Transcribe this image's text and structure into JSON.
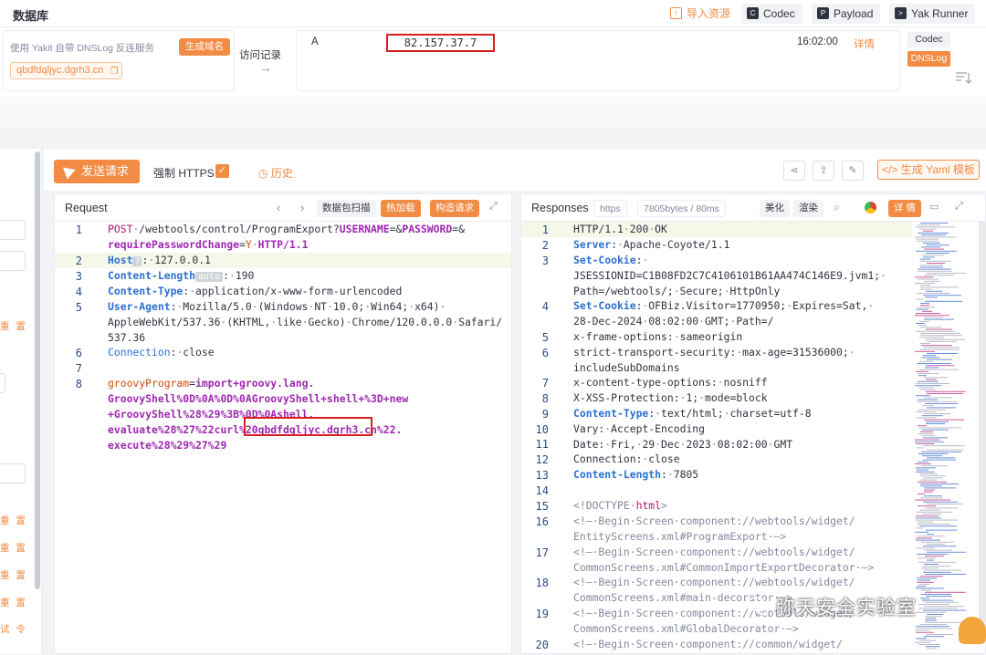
{
  "topbar": {
    "title": "数据库",
    "buttons": [
      {
        "label": "导入资源",
        "icon": "import-icon"
      },
      {
        "label": "Codec",
        "icon": "codec-icon"
      },
      {
        "label": "Payload",
        "icon": "payload-icon"
      },
      {
        "label": "Yak Runner",
        "icon": "terminal-icon"
      }
    ]
  },
  "dnslog": {
    "description": "使用 Yakit 自带 DNSLog 反连服务",
    "generate_label": "生成域名",
    "domain": "qbdfdqljyc.dgrh3.cn",
    "visit_label": "访问记录",
    "record": {
      "type": "A",
      "ip": "82.157.37.7",
      "time": "16:02:00",
      "detail": "详情"
    },
    "tabs": [
      "Codec",
      "DNSLog"
    ]
  },
  "left_sidebar": {
    "labels": [
      "重 置",
      "重 置",
      "重 置",
      "重 置",
      "重 置",
      "试 令"
    ]
  },
  "toolbar": {
    "send_label": "发送请求",
    "https_label": "强制 HTTPS",
    "https_checked": "✓",
    "history_label": "历史",
    "yaml_label": "生成 Yaml 模板"
  },
  "request": {
    "title": "Request",
    "buttons": [
      "数据包扫描",
      "热加载",
      "构造请求"
    ],
    "line_numbers": [
      "1",
      "2",
      "3",
      "4",
      "5",
      "6",
      "7",
      "8"
    ]
  },
  "response": {
    "title": "Responses",
    "protocol": "https",
    "size_time": "7805bytes / 80ms",
    "buttons": [
      "美化",
      "渲染",
      "详 情"
    ],
    "line_numbers": [
      "1",
      "2",
      "3",
      "4",
      "5",
      "6",
      "7",
      "8",
      "9",
      "10",
      "11",
      "12",
      "13",
      "14",
      "15",
      "16",
      "17",
      "18",
      "19",
      "20"
    ]
  },
  "watermark": "弥天安全实验室",
  "colors": {
    "accent": "#f28b44",
    "highlight_box": "#d81e1e",
    "header_key": "#2b6fd1",
    "param_key": "#9d27b0"
  }
}
